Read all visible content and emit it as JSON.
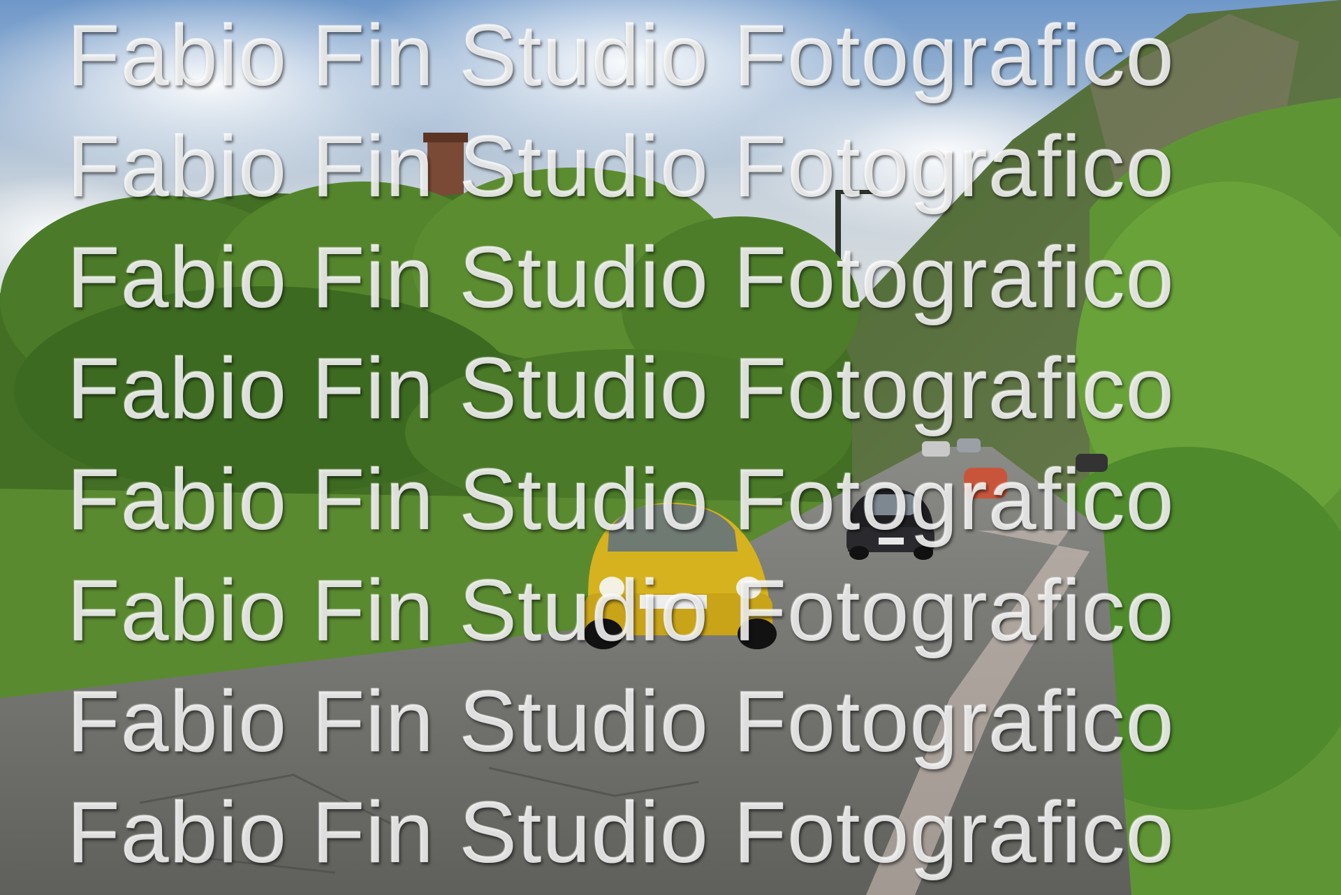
{
  "watermark": {
    "text": "Fabio Fin Studio Fotografico",
    "lines": [
      "Fabio Fin Studio Fotografico",
      "Fabio Fin Studio Fotografico",
      "Fabio Fin Studio Fotografico",
      "Fabio Fin Studio Fotografico",
      "Fabio Fin Studio Fotografico",
      "Fabio Fin Studio Fotografico",
      "Fabio Fin Studio Fotografico",
      "Fabio Fin Studio Fotografico"
    ]
  },
  "scene": {
    "subject": "vintage small cars driving on a rural road",
    "colors": {
      "sky": "#9db6cf",
      "foliage": "#4f7a2a",
      "road": "#6e6f6a",
      "lead_car": "#d6b21e",
      "second_car": "#1f1f22"
    }
  }
}
